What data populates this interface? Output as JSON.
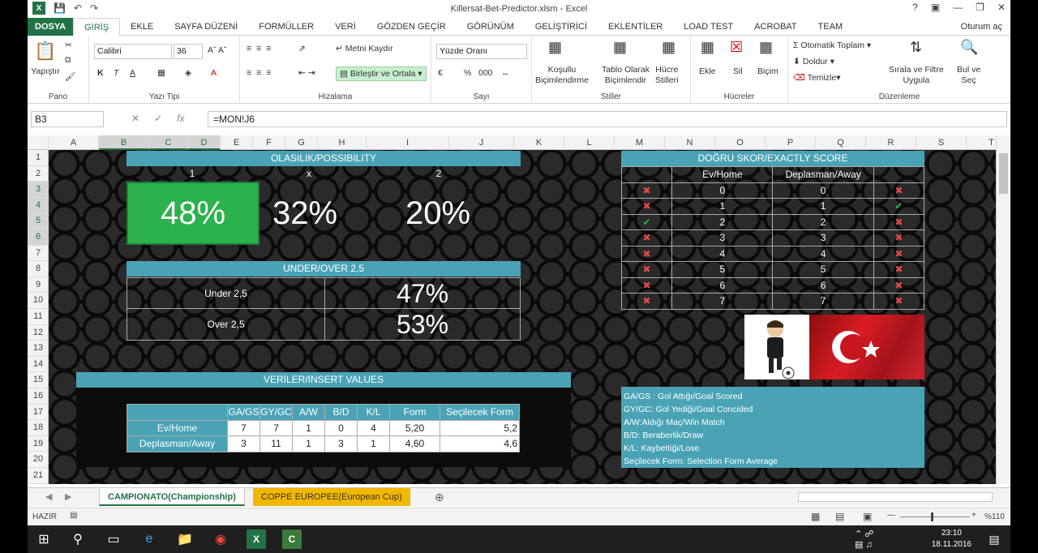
{
  "window": {
    "title": "Killersat-Bet-Predictor.xlsm - Excel",
    "signin": "Oturum aç"
  },
  "tabs": [
    "DOSYA",
    "GİRİŞ",
    "EKLE",
    "SAYFA DÜZENİ",
    "FORMÜLLER",
    "VERİ",
    "GÖZDEN GEÇİR",
    "GÖRÜNÜM",
    "GELİŞTİRİCİ",
    "EKLENTİLER",
    "LOAD TEST",
    "ACROBAT",
    "TEAM"
  ],
  "ribbon": {
    "paste": "Yapıştır",
    "pano": "Pano",
    "font_name": "Calibri",
    "font_size": "36",
    "bold": "K",
    "italic": "T",
    "underline": "A",
    "fill_a": "A",
    "yazi_tipi": "Yazı Tipi",
    "wrap": "Metni Kaydır",
    "merge": "Birleştir ve Ortala",
    "hizalama": "Hizalama",
    "number_format": "Yüzde Oranı",
    "percent": "%",
    "sayi": "Sayı",
    "cond_fmt_1": "Koşullu",
    "cond_fmt_2": "Biçimlendirme",
    "table_fmt_1": "Tablo Olarak",
    "table_fmt_2": "Biçimlendir",
    "cell_styles_1": "Hücre",
    "cell_styles_2": "Stilleri",
    "stiller": "Stiller",
    "insert": "Ekle",
    "delete": "Sil",
    "format": "Biçim",
    "hucreler": "Hücreler",
    "autosum": "Otomatik Toplam",
    "fill": "Doldur",
    "clear": "Temizle",
    "sort_1": "Sırala ve Filtre",
    "sort_2": "Uygula",
    "find_1": "Bul ve",
    "find_2": "Seç",
    "duzenleme": "Düzenleme"
  },
  "formula_bar": {
    "name_box": "B3",
    "fx": "fx",
    "formula": "=MON!J6"
  },
  "columns": [
    "A",
    "B",
    "C",
    "D",
    "E",
    "F",
    "G",
    "H",
    "I",
    "J",
    "K",
    "L",
    "M",
    "N",
    "O",
    "P",
    "Q",
    "R",
    "S",
    "T",
    "U",
    "V"
  ],
  "rows": [
    "1",
    "2",
    "3",
    "4",
    "5",
    "6",
    "7",
    "8",
    "9",
    "10",
    "11",
    "12",
    "13",
    "14",
    "15",
    "16",
    "17",
    "18",
    "19",
    "20",
    "21"
  ],
  "sheet": {
    "possibility_title": "OLASILIK/POSSIBILITY",
    "outcome_labels": [
      "1",
      "x",
      "2"
    ],
    "outcome_values": [
      "48%",
      "32%",
      "20%"
    ],
    "underover_title": "UNDER/OVER 2,5",
    "under_label": "Under 2,5",
    "under_value": "47%",
    "over_label": "Over 2,5",
    "over_value": "53%",
    "score_title": "DOĞRU SKOR/EXACTLY SCORE",
    "score_headers": [
      "Ev/Home",
      "Deplasman/Away"
    ],
    "scores": [
      {
        "home": "0",
        "away": "0",
        "l": "x",
        "r": "x"
      },
      {
        "home": "1",
        "away": "1",
        "l": "x",
        "r": "check"
      },
      {
        "home": "2",
        "away": "2",
        "l": "check",
        "r": "x"
      },
      {
        "home": "3",
        "away": "3",
        "l": "x",
        "r": "x"
      },
      {
        "home": "4",
        "away": "4",
        "l": "x",
        "r": "x"
      },
      {
        "home": "5",
        "away": "5",
        "l": "x",
        "r": "x"
      },
      {
        "home": "6",
        "away": "6",
        "l": "x",
        "r": "x"
      },
      {
        "home": "7",
        "away": "7",
        "l": "x",
        "r": "x"
      }
    ],
    "insert_title": "VERİLER/INSERT VALUES",
    "insert_headers": [
      "GA/GS",
      "GY/GC",
      "A/W",
      "B/D",
      "K/L",
      "Form",
      "Seçilecek Form"
    ],
    "insert_rows": [
      {
        "label": "Ev/Home",
        "values": [
          "7",
          "7",
          "1",
          "0",
          "4",
          "5,20",
          "5,2"
        ]
      },
      {
        "label": "Deplasman/Away",
        "values": [
          "3",
          "11",
          "1",
          "3",
          "1",
          "4,60",
          "4,6"
        ]
      }
    ],
    "legend": [
      "GA/GS : Gol Attığı/Goal Scored",
      "GY/GC: Gol Yediği/Goal Concided",
      "A/W:Aldığı Maç/Win Match",
      "B/D: Beraberlik/Draw",
      "K/L: Kaybettiği/Lose",
      "Seçilecek Form: Selection Form Average"
    ]
  },
  "sheet_tabs": [
    "CAMPIONATO(Championship)",
    "COPPE EUROPEE(European Cup)"
  ],
  "status": {
    "ready": "HAZIR",
    "zoom": "%110"
  },
  "taskbar": {
    "time": "23:10",
    "date": "18.11.2016"
  },
  "colors": {
    "excel_green": "#217346",
    "teal": "#4aa3b5",
    "selected_cell": "#2bb24c",
    "cross": "#e04a4a"
  }
}
